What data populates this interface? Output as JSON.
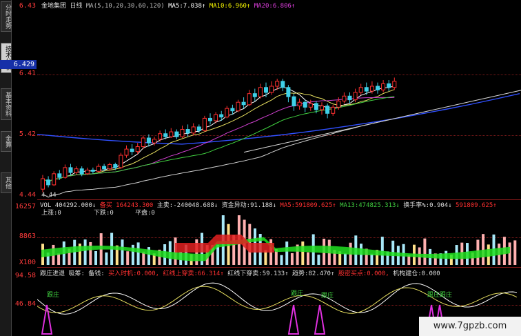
{
  "sidebar": {
    "tabs": [
      {
        "label": "分时走势",
        "active": false
      },
      {
        "label": "技术分析",
        "active": true
      },
      {
        "label": "基本资料",
        "active": false
      },
      {
        "label": "金算",
        "active": false
      },
      {
        "label": "其他",
        "active": false
      }
    ]
  },
  "main_chart": {
    "stock_name": "金地集团",
    "period": "日线",
    "ma_params": "MA(5,10,20,30,60,120)",
    "ma5_label": "MA5:",
    "ma5_value": "7.038↑",
    "ma10_label": "MA10:",
    "ma10_value": "6.960↑",
    "ma20_label": "MA20:",
    "ma20_value": "6.806↑",
    "y_ticks": [
      "6.41",
      "5.42",
      "4.44"
    ],
    "top_label": "6.43",
    "current_price": "6.429",
    "low_annotation": "4.44",
    "colors": {
      "up": "#ff3030",
      "down": "#3fd0e8",
      "ma5": "#ffffff",
      "ma10": "#e8e060",
      "ma20": "#d040d0",
      "ma30": "#40d040",
      "ma60": "#d0d0d0",
      "ma120": "#3050ff"
    }
  },
  "volume_chart": {
    "label": "VOL",
    "vol_value": "404292.000↓",
    "status_text": "备买",
    "status_value": "164243.300",
    "main_buy_label": "主卖:",
    "main_buy_value": "-240048.688↓",
    "capital_label": "资金异动:",
    "capital_value": "91.188↓",
    "ma5_label": "MA5:",
    "ma5_value": "591809.625↑",
    "ma13_label": "MA13:",
    "ma13_value": "474825.313↓",
    "turnover_label": "换手率%:",
    "turnover_value": "0.904↓",
    "turnover_extra": "591809.625↑",
    "turnover_extra2": "5918",
    "up_label": "上涨:0",
    "down_label": "下跌:0",
    "flat_label": "平盘:0",
    "y_ticks": [
      "16257",
      "8863",
      "X100"
    ]
  },
  "indicator_chart": {
    "title": "跟庄进退",
    "t1": "吸筹:",
    "t2": "备钱:",
    "t3": "买入时机:",
    "t3_value": "0.000,",
    "t4": "红线上穿卖:",
    "t4_value": "66.314↑",
    "t5": "红线下穿卖:",
    "t5_value": "59.133↑",
    "t6": "趋势:",
    "t6_value": "82.470↑",
    "t7": "股密买点:",
    "t7_value": "0.000,",
    "t8": "机构建仓:",
    "t8_value": "0.000",
    "y_ticks": [
      "94.58",
      "46.84"
    ],
    "marker_label": "跟庄",
    "marker_label2": "跟庄跟庄"
  },
  "chart_data": {
    "type": "candlestick",
    "description_free": true,
    "price_ylim": [
      4.44,
      6.41
    ],
    "candles": [
      [
        4.55,
        4.72,
        4.5,
        4.78
      ],
      [
        4.7,
        4.62,
        4.58,
        4.76
      ],
      [
        4.62,
        4.8,
        4.6,
        4.84
      ],
      [
        4.8,
        4.74,
        4.7,
        4.86
      ],
      [
        4.74,
        4.9,
        4.72,
        4.95
      ],
      [
        4.9,
        4.82,
        4.78,
        4.96
      ],
      [
        4.82,
        4.88,
        4.78,
        4.92
      ],
      [
        4.88,
        4.8,
        4.76,
        4.92
      ],
      [
        4.8,
        4.86,
        4.78,
        4.9
      ],
      [
        4.86,
        4.84,
        4.8,
        4.9
      ],
      [
        4.84,
        4.92,
        4.82,
        4.96
      ],
      [
        4.92,
        4.88,
        4.84,
        4.96
      ],
      [
        4.88,
        4.95,
        4.85,
        4.98
      ],
      [
        4.95,
        4.9,
        4.86,
        4.98
      ],
      [
        4.9,
        5.1,
        4.88,
        5.14
      ],
      [
        5.1,
        5.2,
        5.06,
        5.26
      ],
      [
        5.2,
        5.16,
        5.1,
        5.28
      ],
      [
        5.16,
        5.24,
        5.12,
        5.3
      ],
      [
        5.24,
        5.38,
        5.2,
        5.42
      ],
      [
        5.38,
        5.3,
        5.24,
        5.44
      ],
      [
        5.3,
        5.36,
        5.26,
        5.4
      ],
      [
        5.36,
        5.45,
        5.32,
        5.5
      ],
      [
        5.45,
        5.4,
        5.36,
        5.52
      ],
      [
        5.4,
        5.48,
        5.38,
        5.54
      ],
      [
        5.48,
        5.4,
        5.36,
        5.52
      ],
      [
        5.4,
        5.52,
        5.38,
        5.58
      ],
      [
        5.52,
        5.46,
        5.4,
        5.6
      ],
      [
        5.46,
        5.56,
        5.42,
        5.62
      ],
      [
        5.56,
        5.5,
        5.46,
        5.6
      ],
      [
        5.5,
        5.7,
        5.48,
        5.74
      ],
      [
        5.7,
        5.66,
        5.6,
        5.78
      ],
      [
        5.66,
        5.76,
        5.62,
        5.8
      ],
      [
        5.76,
        5.72,
        5.66,
        5.82
      ],
      [
        5.72,
        5.86,
        5.7,
        5.9
      ],
      [
        5.86,
        5.82,
        5.76,
        5.92
      ],
      [
        5.82,
        5.96,
        5.8,
        6.0
      ],
      [
        5.96,
        5.92,
        5.86,
        6.04
      ],
      [
        5.92,
        6.1,
        5.9,
        6.16
      ],
      [
        6.1,
        6.05,
        5.98,
        6.18
      ],
      [
        6.05,
        6.2,
        6.02,
        6.26
      ],
      [
        6.2,
        6.12,
        6.04,
        6.28
      ],
      [
        6.12,
        6.22,
        6.08,
        6.3
      ],
      [
        6.22,
        6.3,
        6.16,
        6.34
      ],
      [
        6.3,
        6.2,
        6.14,
        6.34
      ],
      [
        6.2,
        6.05,
        5.96,
        6.24
      ],
      [
        6.05,
        5.9,
        5.82,
        6.1
      ],
      [
        5.9,
        5.96,
        5.84,
        6.02
      ],
      [
        5.96,
        5.88,
        5.8,
        6.0
      ],
      [
        5.88,
        5.94,
        5.82,
        6.0
      ],
      [
        5.94,
        5.84,
        5.78,
        5.98
      ],
      [
        5.84,
        5.9,
        5.76,
        5.96
      ],
      [
        5.9,
        5.78,
        5.7,
        5.94
      ],
      [
        5.78,
        5.88,
        5.74,
        5.92
      ],
      [
        5.88,
        5.98,
        5.84,
        6.04
      ],
      [
        5.98,
        6.06,
        5.94,
        6.12
      ],
      [
        6.06,
        6.0,
        5.94,
        6.12
      ],
      [
        6.0,
        6.12,
        5.96,
        6.18
      ],
      [
        6.12,
        6.2,
        6.08,
        6.26
      ],
      [
        6.2,
        6.14,
        6.08,
        6.28
      ],
      [
        6.14,
        6.22,
        6.1,
        6.3
      ],
      [
        6.22,
        6.16,
        6.1,
        6.28
      ],
      [
        6.16,
        6.26,
        6.12,
        6.32
      ],
      [
        6.26,
        6.2,
        6.14,
        6.32
      ],
      [
        6.2,
        6.3,
        6.16,
        6.36
      ]
    ],
    "volume_ylim": [
      0,
      16257
    ],
    "indicator_ylim": [
      0,
      94.58
    ]
  }
}
